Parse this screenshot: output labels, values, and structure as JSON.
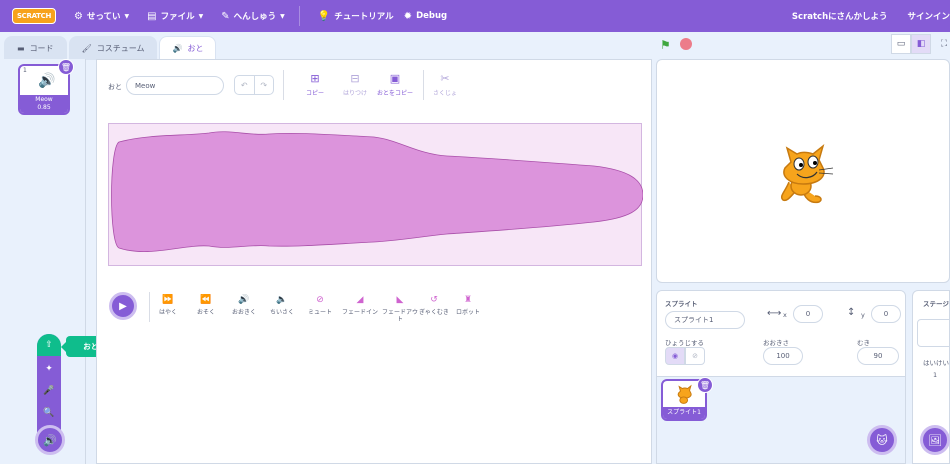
{
  "menubar": {
    "logo": "SCRATCH",
    "settings": "せってい",
    "file": "ファイル",
    "edit": "へんしゅう",
    "tutorial": "チュートリアル",
    "debug": "Debug",
    "join": "Scratchにさんかしよう",
    "signin": "サインイン"
  },
  "tabs": {
    "code": "コード",
    "costume": "コスチューム",
    "sound": "おと"
  },
  "sound_list": [
    {
      "index": "1",
      "name": "Meow",
      "duration": "0.85"
    }
  ],
  "editor": {
    "name_label": "おと",
    "name_value": "Meow",
    "tools": {
      "copy": "コピー",
      "paste": "はりつけ",
      "copy_to_new": "おとをコピー",
      "delete": "さくじょ"
    }
  },
  "effects": [
    {
      "label": "はやく",
      "icon": "faster-icon"
    },
    {
      "label": "おそく",
      "icon": "slower-icon"
    },
    {
      "label": "おおきく",
      "icon": "louder-icon"
    },
    {
      "label": "ちいさく",
      "icon": "softer-icon"
    },
    {
      "label": "ミュート",
      "icon": "mute-icon"
    },
    {
      "label": "フェードイン",
      "icon": "fade-in-icon"
    },
    {
      "label": "フェードアウト",
      "icon": "fade-out-icon"
    },
    {
      "label": "ぎゃくむき",
      "icon": "reverse-icon"
    },
    {
      "label": "ロボット",
      "icon": "robot-icon"
    }
  ],
  "tooltip": "おとをアップロードする",
  "sprite_info": {
    "label": "スプライト",
    "name": "スプライト1",
    "x_label": "x",
    "x": "0",
    "y_label": "y",
    "y": "0",
    "show_label": "ひょうじする",
    "size_label": "おおきさ",
    "size": "100",
    "direction_label": "むき",
    "direction": "90"
  },
  "sprites": [
    {
      "name": "スプライト1"
    }
  ],
  "stage_pane": {
    "label": "ステージ",
    "backdrops_label": "はいけい",
    "backdrops_count": "1"
  },
  "colors": {
    "accent": "#855cd6",
    "sound": "#cf63cf",
    "green": "#0fbd8c"
  }
}
